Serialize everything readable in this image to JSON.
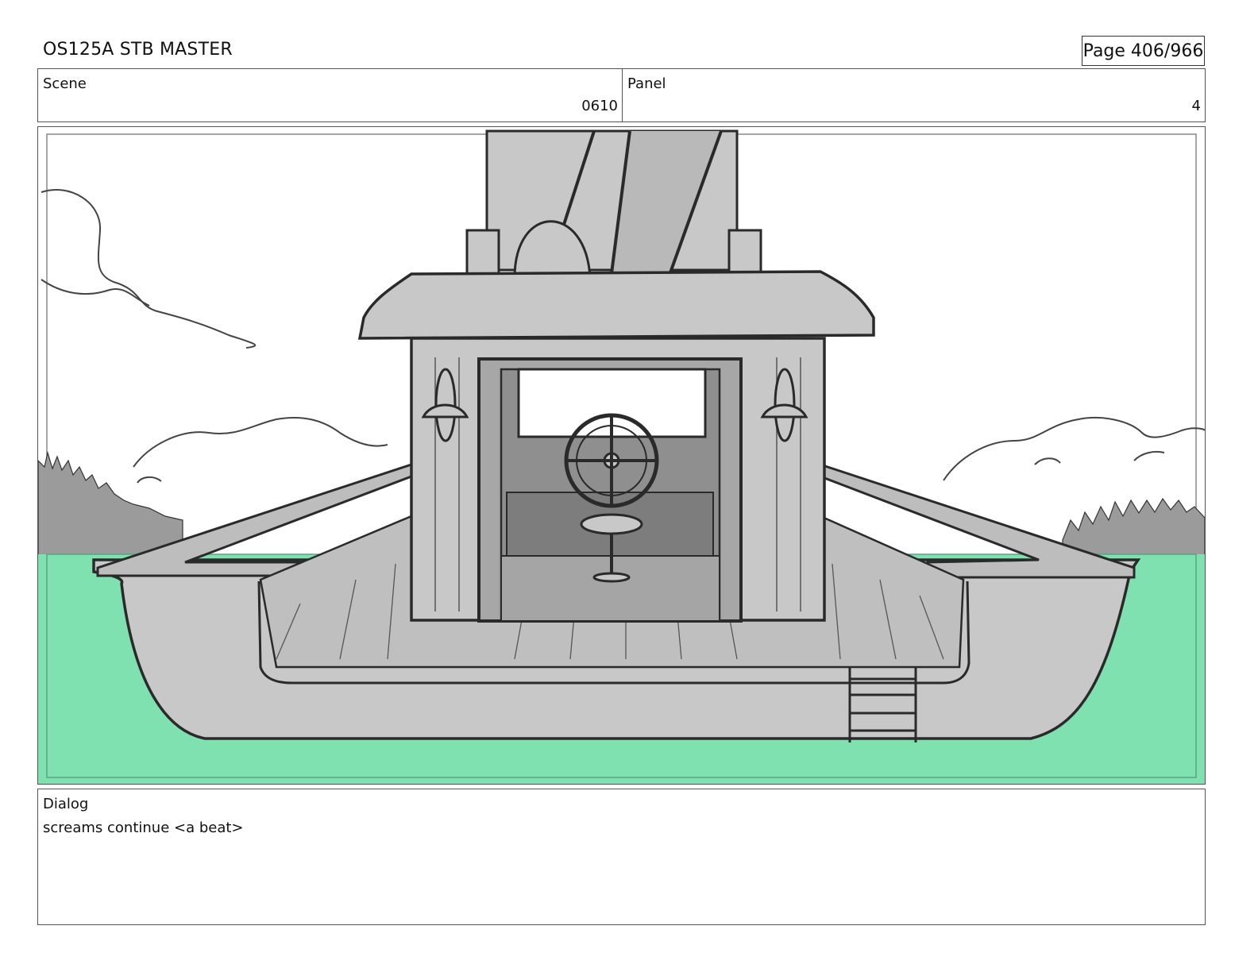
{
  "header": {
    "title": "OS125A STB MASTER",
    "page": "Page 406/966"
  },
  "scene": {
    "label": "Scene",
    "value": "0610"
  },
  "panel": {
    "label": "Panel",
    "value": "4"
  },
  "dialog": {
    "label": "Dialog",
    "text": "screams continue <a beat>"
  },
  "colors": {
    "water": "#7fe0b0",
    "boat": "#c8c8c8",
    "trees": "#9b9b9b",
    "line": "#2a2a2a"
  }
}
